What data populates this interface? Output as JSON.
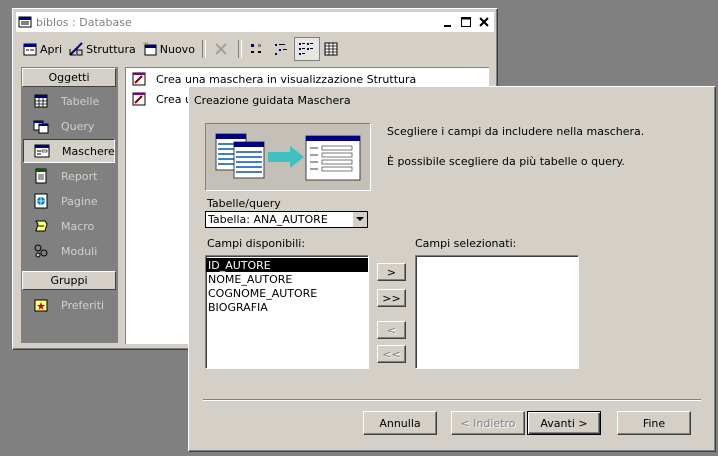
{
  "db_window": {
    "title": "biblos : Database",
    "title_buttons": [
      "minimize",
      "maximize",
      "close"
    ],
    "toolbar": {
      "open_label": "Apri",
      "design_label": "Struttura",
      "new_label": "Nuovo"
    },
    "groups": {
      "objects_header": "Oggetti",
      "groups_header": "Gruppi"
    },
    "objects": [
      {
        "label": "Tabelle",
        "icon": "table-icon"
      },
      {
        "label": "Query",
        "icon": "query-icon"
      },
      {
        "label": "Maschere",
        "icon": "form-icon",
        "selected": true
      },
      {
        "label": "Report",
        "icon": "report-icon"
      },
      {
        "label": "Pagine",
        "icon": "page-icon"
      },
      {
        "label": "Macro",
        "icon": "macro-icon"
      },
      {
        "label": "Moduli",
        "icon": "module-icon"
      }
    ],
    "favorites_label": "Preferiti",
    "list": [
      {
        "label": "Crea una maschera in visualizzazione Struttura"
      },
      {
        "label": "Crea u"
      }
    ]
  },
  "wizard": {
    "title": "Creazione guidata Maschera",
    "instruction1": "Scegliere i campi da includere nella maschera.",
    "instruction2": "È possibile scegliere da più tabelle o query.",
    "table_query_label": "Tabelle/query",
    "table_query_value": "Tabella: ANA_AUTORE",
    "available_label": "Campi disponibili:",
    "selected_label": "Campi selezionati:",
    "available_fields": [
      "ID_AUTORE",
      "NOME_AUTORE",
      "COGNOME_AUTORE",
      "BIOGRAFIA"
    ],
    "selected_field_index": 0,
    "selected_fields": [],
    "move_buttons": {
      "add_one": ">",
      "add_all": ">>",
      "remove_one": "<",
      "remove_all": "<<"
    },
    "buttons": {
      "cancel": "Annulla",
      "back": "< Indietro",
      "next": "Avanti >",
      "finish": "Fine"
    }
  }
}
